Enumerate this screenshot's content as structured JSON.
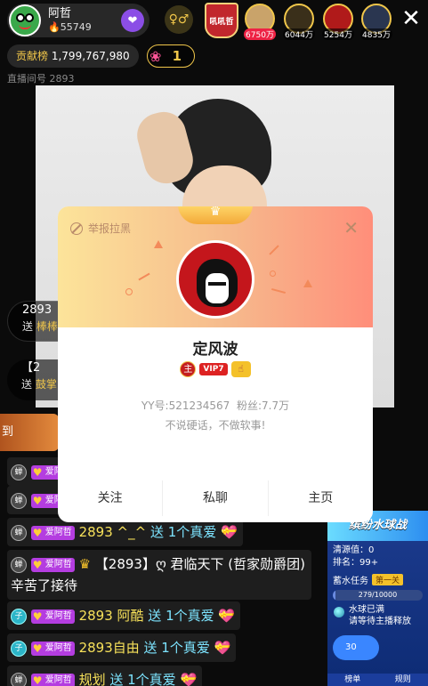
{
  "host": {
    "name": "阿哲",
    "fans": "55749"
  },
  "brand_badge": "吼吼哲",
  "viewers": [
    {
      "count": "6750万",
      "color": "#c9a36a"
    },
    {
      "count": "6044万",
      "color": "#3a2f1a"
    },
    {
      "count": "5254万",
      "color": "#b01a1a"
    },
    {
      "count": "4835万",
      "color": "#2a3650"
    }
  ],
  "contribution": {
    "label": "贡献榜",
    "value": "1,799,767,980"
  },
  "rank_number": "1",
  "room_id": "直播间号 2893",
  "gift_bubbles": [
    {
      "title": "2893",
      "prefix": "送",
      "gift": "棒棒"
    },
    {
      "title": "【2",
      "prefix": "送",
      "gift": "鼓掌"
    }
  ],
  "orange_bar_text": "到",
  "popup": {
    "report": "举报拉黑",
    "nickname": "定风波",
    "badges": {
      "host": "主",
      "vip": "VIP7"
    },
    "yy_id": "YY号:521234567",
    "fans": "粉丝:7.7万",
    "signature": "不说硬话，不做软事!",
    "actions": [
      "关注",
      "私聊",
      "主页"
    ]
  },
  "chat": [
    {
      "level": "蝉",
      "fan_badge": "爱阿哲",
      "user": "",
      "text": "",
      "gift": ""
    },
    {
      "level": "蝉",
      "fan_badge": "爱阿",
      "user": "",
      "text": "",
      "gift": ""
    },
    {
      "level": "蝉",
      "fan_badge": "爱阿哲",
      "user": "2893 ^_^",
      "text": "送 1个真爱",
      "gift": "💝"
    },
    {
      "level": "蝉",
      "fan_badge": "爱阿哲",
      "user": "【2893】ღ 君临天下 (哲家勋爵团) 辛苦了接待",
      "text": "",
      "gift": ""
    },
    {
      "level": "子",
      "fan_badge": "爱阿哲",
      "user": "2893 阿酷",
      "text": "送 1个真爱",
      "gift": "💝"
    },
    {
      "level": "子",
      "fan_badge": "爱阿哲",
      "user": "2893自由",
      "text": "送 1个真爱",
      "gift": "💝"
    },
    {
      "level": "蝉",
      "fan_badge": "爱阿哲",
      "user": "规划",
      "text": "送 1个真爱",
      "gift": "💝"
    }
  ],
  "side_card": {
    "title": "缤纷水球战",
    "clean_value": "清源值：0",
    "rank": "排名：99+",
    "task_label": "蓄水任务",
    "task_tag": "第一关",
    "progress_text": "279/10000",
    "progress": 0.0279,
    "status1": "水球已满",
    "status2": "请等待主播释放",
    "bubble": "30",
    "tabs": [
      "榜单",
      "规则"
    ]
  }
}
